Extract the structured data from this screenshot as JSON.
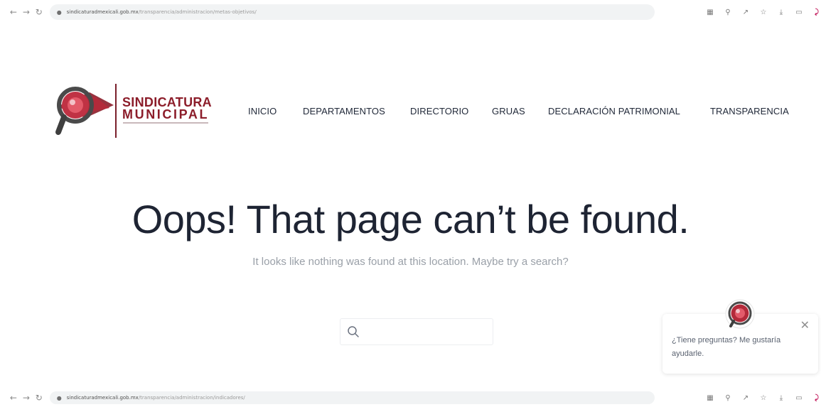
{
  "browser_top": {
    "url_host": "sindicaturadmexicali.gob.mx",
    "url_path": "/transparencia/administracion/metas-objetivos/"
  },
  "browser_bottom": {
    "url_host": "sindicaturadmexicali.gob.mx",
    "url_path": "/transparencia/administracion/indicadores/"
  },
  "toolbar_icons": [
    "translate-icon",
    "zoom-icon",
    "share-icon",
    "star-icon",
    "download-icon",
    "tab-icon",
    "extension-icon"
  ],
  "logo": {
    "line1": "SINDICATURA",
    "line2": "MUNICIPAL"
  },
  "nav": {
    "items": [
      "INICIO",
      "DEPARTAMENTOS",
      "DIRECTORIO",
      "GRUAS",
      "DECLARACIÓN PATRIMONIAL",
      "TRANSPARENCIA"
    ]
  },
  "error_page": {
    "title": "Oops! That page can’t be found.",
    "subtitle": "It looks like nothing was found at this location. Maybe try a search?"
  },
  "search": {
    "placeholder": "",
    "value": ""
  },
  "chat": {
    "message": "¿Tiene preguntas? Me gustaría ayudarle."
  },
  "colors": {
    "brand": "#8c1d2a",
    "text_dark": "#1e2433",
    "text_muted": "#9aa0a8"
  }
}
